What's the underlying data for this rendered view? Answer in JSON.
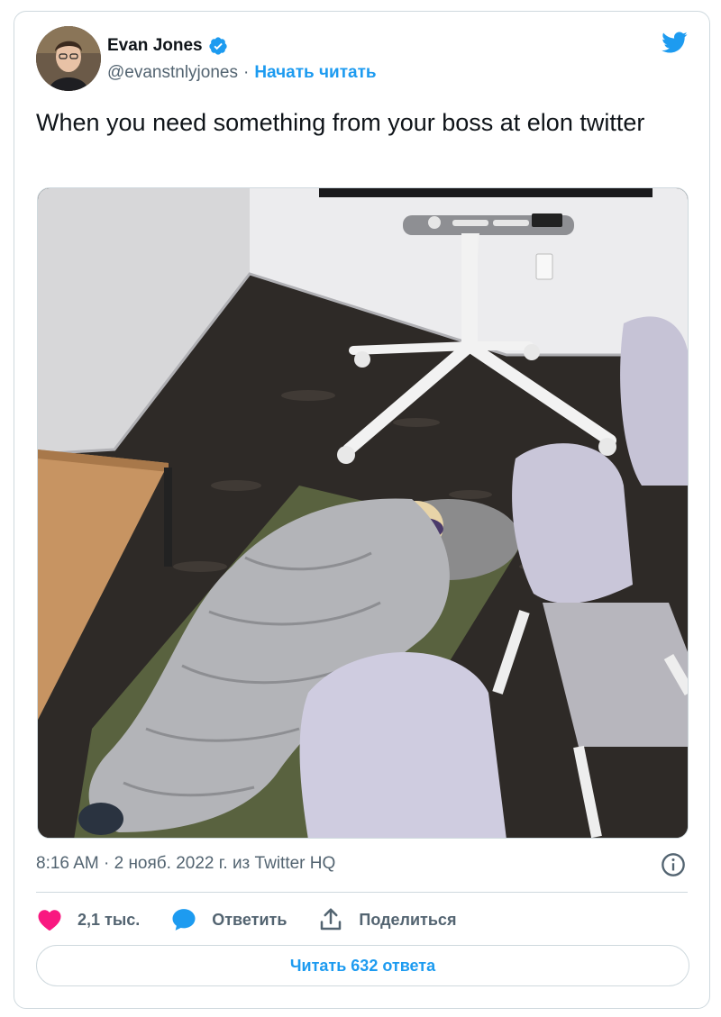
{
  "author": {
    "name": "Evan Jones",
    "handle": "@evanstnlyjones",
    "separator": "·",
    "follow_label": "Начать читать"
  },
  "tweet": {
    "text": "When you need something from your boss at elon twitter"
  },
  "meta": {
    "line": "8:16 AM · 2 нояб. 2022 г. из Twitter HQ"
  },
  "actions": {
    "like_count": "2,1 тыс.",
    "reply_label": "Ответить",
    "share_label": "Поделиться"
  },
  "replies_button": {
    "label": "Читать 632 ответа"
  },
  "icons": {
    "verified": "verified-badge-icon",
    "brand": "twitter-bird-icon",
    "info": "info-icon",
    "like": "heart-icon",
    "reply": "speech-bubble-icon",
    "share": "share-icon"
  },
  "colors": {
    "brand_blue": "#1d9bf0",
    "like_pink": "#f91880",
    "text_primary": "#0f1419",
    "text_secondary": "#536471",
    "border": "#cfd9de"
  }
}
